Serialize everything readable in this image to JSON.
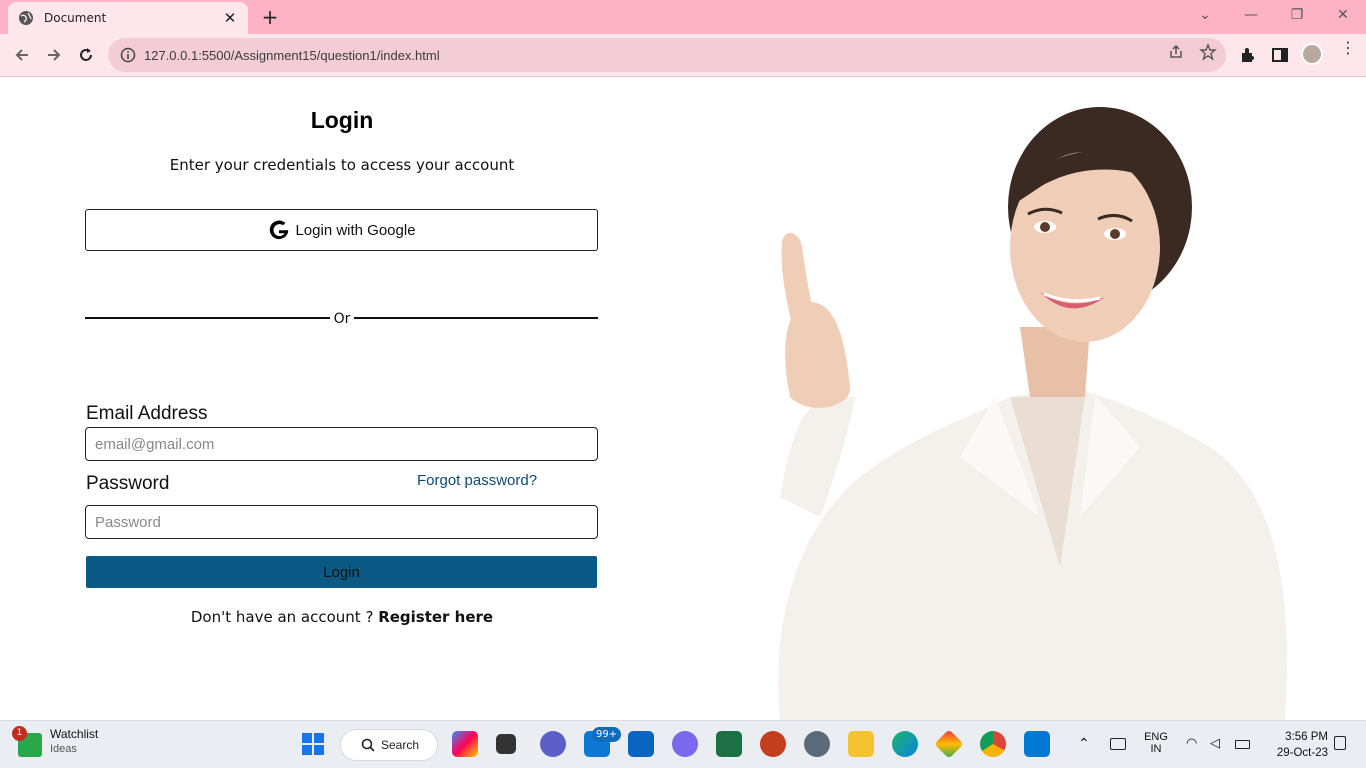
{
  "browser": {
    "tab_title": "Document",
    "url": "127.0.0.1:5500/Assignment15/question1/index.html"
  },
  "login": {
    "title": "Login",
    "subtitle": "Enter your credentials to access your account",
    "google_label": "Login with Google",
    "divider": "Or",
    "email_label": "Email Address",
    "email_placeholder": "email@gmail.com",
    "password_label": "Password",
    "forgot": "Forgot password?",
    "password_placeholder": "Password",
    "submit_label": "Login",
    "register_prompt": "Don't have an account ? ",
    "register_link": "Register here"
  },
  "taskbar": {
    "widget_title": "Watchlist",
    "widget_sub": "Ideas",
    "widget_badge": "1",
    "search_label": "Search",
    "mail_badge": "99+",
    "lang_top": "ENG",
    "lang_bottom": "IN",
    "time": "3:56 PM",
    "date": "29-Oct-23"
  },
  "colors": {
    "titlebar": "#fdb3c5",
    "toolbar": "#fde7ed",
    "submit": "#0a5a85",
    "link": "#0b4a7a"
  }
}
